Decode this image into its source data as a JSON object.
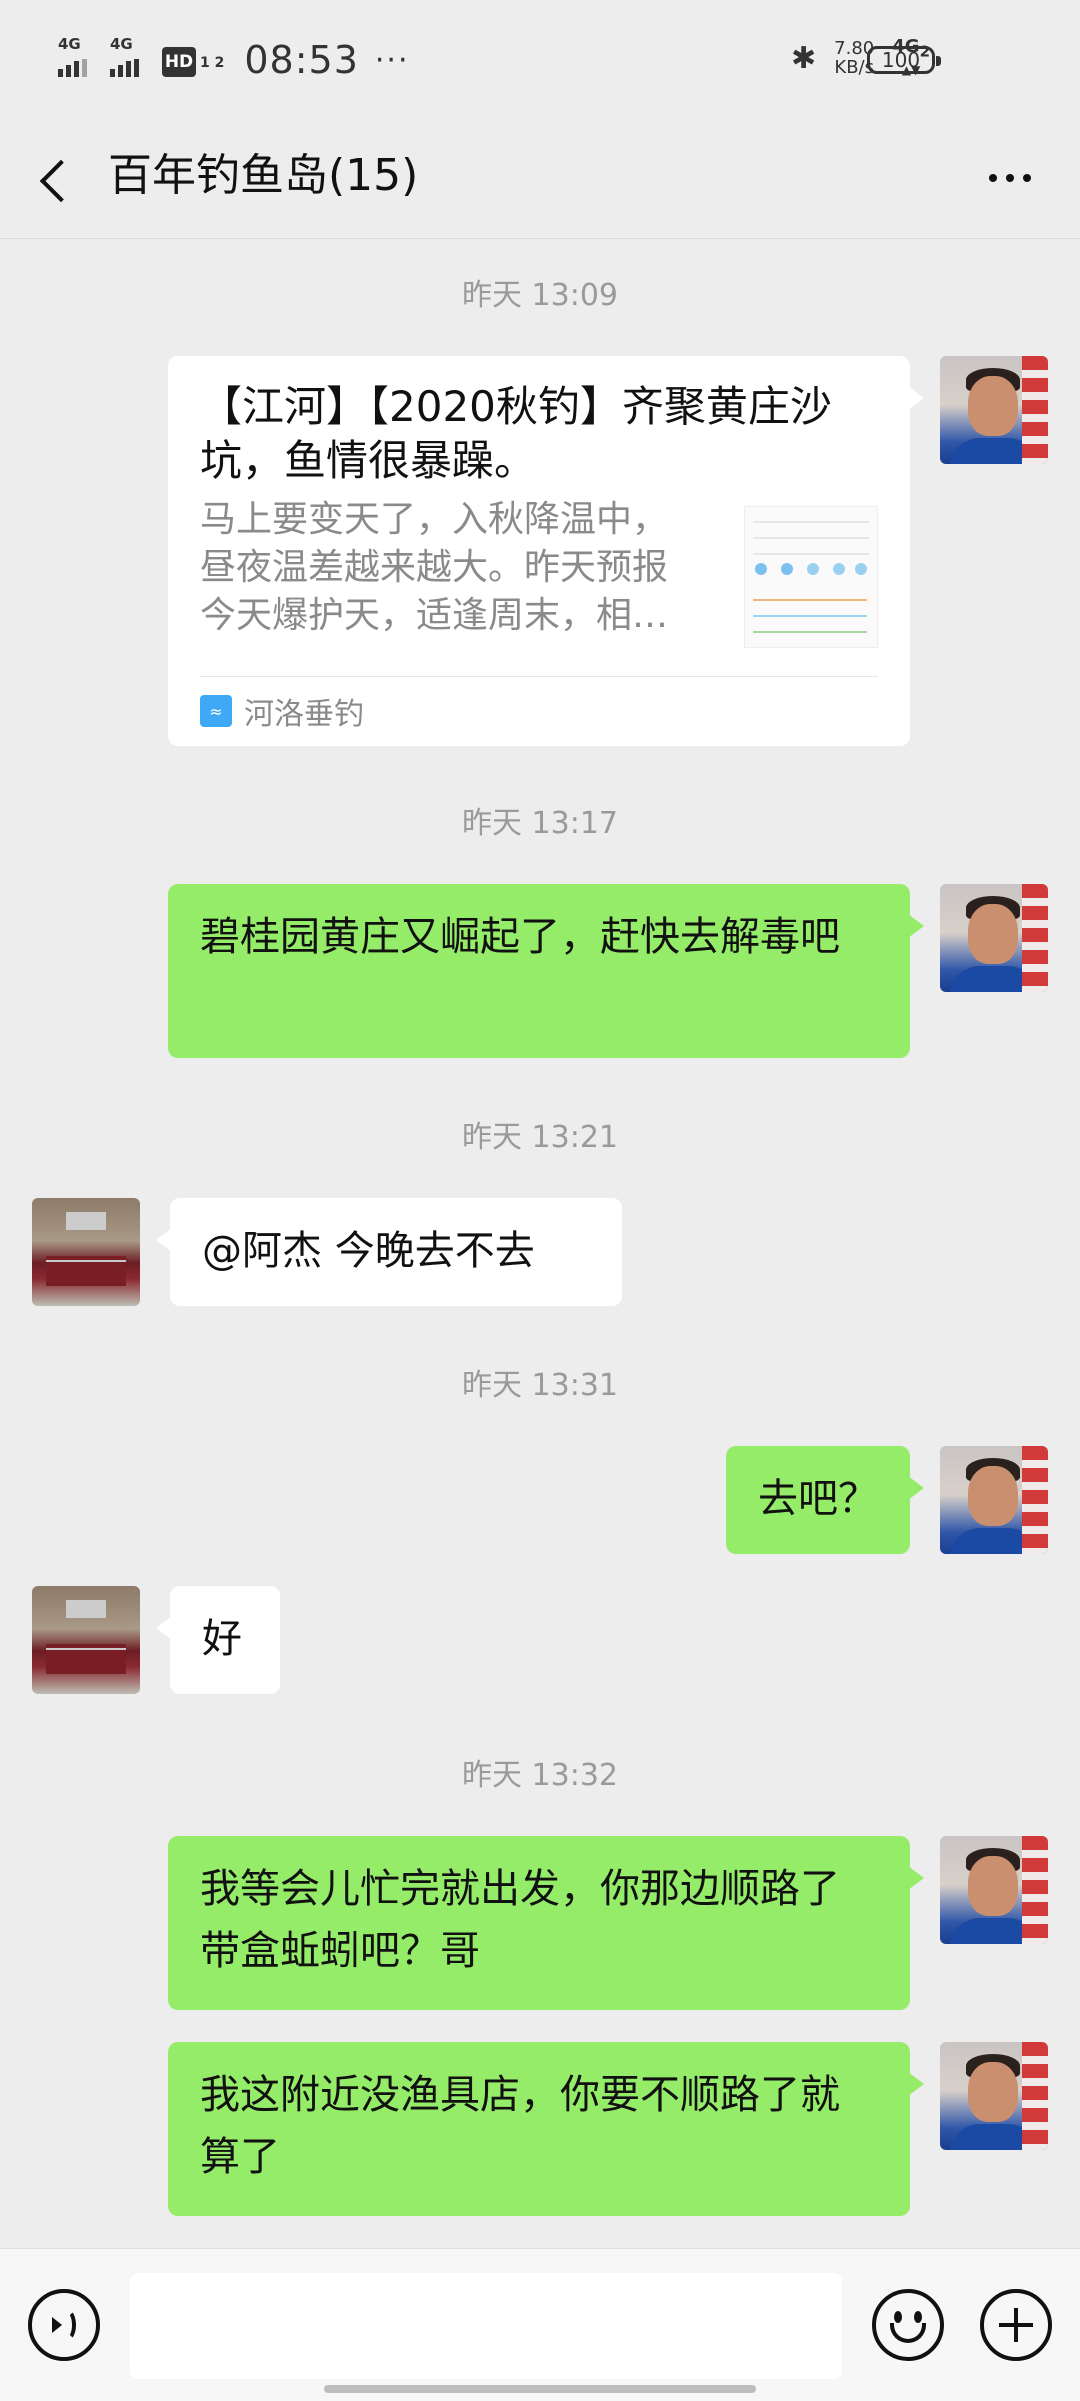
{
  "status_bar": {
    "sim1": "4G",
    "sim2": "4G",
    "hd_label": "HD",
    "hd_sub": "1 2",
    "time": "08:53",
    "more": "···",
    "speed_value": "7.80",
    "speed_unit": "KB/s",
    "network": "4G",
    "network_sub": "2",
    "battery": "100"
  },
  "header": {
    "title": "百年钓鱼岛(15)"
  },
  "messages": [
    {
      "type": "time",
      "text": "昨天 13:09"
    },
    {
      "type": "link",
      "side": "self",
      "title": "【江河】【2020秋钓】齐聚黄庄沙坑，鱼情很暴躁。",
      "desc": "马上要变天了，入秋降温中，昼夜温差越来越大。昨天预报今天爆护天，适逢周末，相…",
      "source": "河洛垂钓"
    },
    {
      "type": "time",
      "text": "昨天 13:17"
    },
    {
      "type": "text",
      "side": "self",
      "text": "碧桂园黄庄又崛起了，赶快去解毒吧"
    },
    {
      "type": "time",
      "text": "昨天 13:21"
    },
    {
      "type": "text",
      "side": "other",
      "text": "@阿杰  今晚去不去"
    },
    {
      "type": "time",
      "text": "昨天 13:31"
    },
    {
      "type": "text",
      "side": "self",
      "text": "去吧？"
    },
    {
      "type": "text",
      "side": "other",
      "text": "好"
    },
    {
      "type": "time",
      "text": "昨天 13:32"
    },
    {
      "type": "text",
      "side": "self",
      "text": "我等会儿忙完就出发，你那边顺路了带盒蚯蚓吧？哥"
    },
    {
      "type": "text",
      "side": "self",
      "text": "我这附近没渔具店，你要不顺路了就算了"
    }
  ],
  "input_bar": {
    "voice_icon": "voice-icon",
    "emoji_icon": "emoji-icon",
    "plus_icon": "plus-icon",
    "placeholder": ""
  },
  "colors": {
    "background": "#ededed",
    "self_bubble": "#95ec69",
    "other_bubble": "#ffffff",
    "timestamp": "#9a9a9a"
  }
}
